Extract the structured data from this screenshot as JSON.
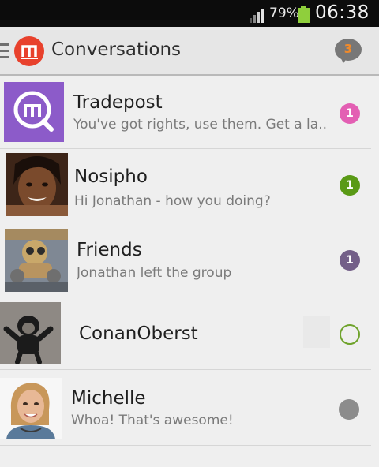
{
  "status_bar": {
    "battery_percent": "79%",
    "time": "06:38",
    "signal_icon": "signal-icon",
    "battery_icon": "battery-icon",
    "battery_color": "#8fcf3c"
  },
  "action_bar": {
    "title": "Conversations",
    "unread_count": "3",
    "logo_icon": "mxit-logo-icon",
    "accent": "#e8412c"
  },
  "conversations": [
    {
      "name": "Tradepost",
      "preview": "You've got rights, use them. Get a la..",
      "unread": "1",
      "badge_color": "#e35fb3"
    },
    {
      "name": "Nosipho",
      "preview": "Hi Jonathan - how you doing?",
      "unread": "1",
      "badge_color": "#5a9a16"
    },
    {
      "name": "Friends",
      "preview": "Jonathan left the group",
      "unread": "1",
      "badge_color": "#735f88"
    },
    {
      "name": "ConanOberst",
      "preview": "",
      "unread": "",
      "badge_color": "#6fa32c"
    },
    {
      "name": "Michelle",
      "preview": "Whoa! That's awesome!",
      "unread": "",
      "badge_color": "#8c8c8c"
    }
  ]
}
